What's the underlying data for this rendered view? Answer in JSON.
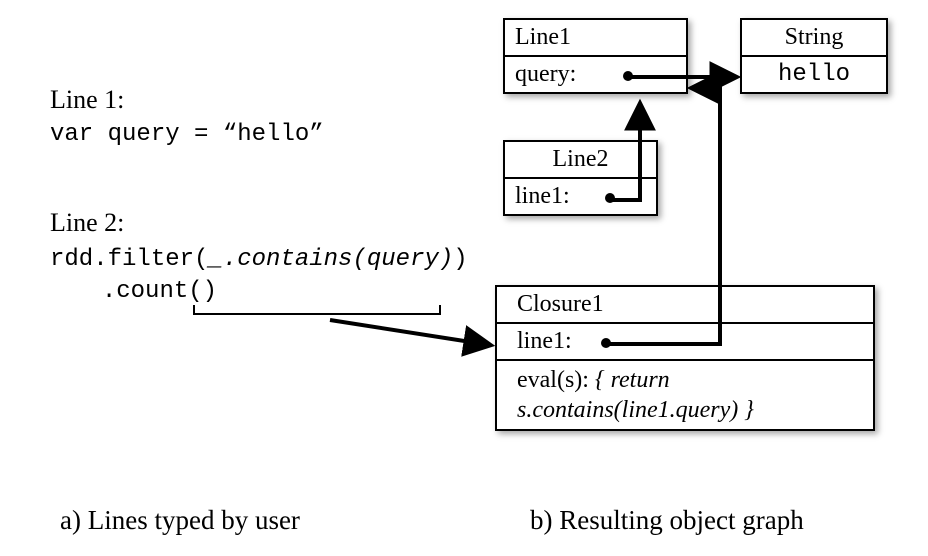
{
  "left": {
    "line1_label": "Line 1:",
    "line1_pre": "var query = ",
    "line1_openq": "“",
    "line1_val": "hello",
    "line1_closeq": "”",
    "line2_label": "Line 2:",
    "line2_a": "rdd.filter(",
    "line2_closure": "_.contains(query)",
    "line2_b": ")",
    "line2_c": ".count()"
  },
  "right": {
    "line1_title": "Line1",
    "line1_field": "query:",
    "string_title": "String",
    "string_value": "hello",
    "line2_title": "Line2",
    "line2_field": "line1:",
    "closure_title": "Closure1",
    "closure_field": "line1:",
    "eval_label": "eval(s): ",
    "eval_open": "{ return",
    "eval_body": " s.contains(line1.query) }"
  },
  "captions": {
    "a": "a) Lines typed by user",
    "b": "b) Resulting object graph"
  }
}
